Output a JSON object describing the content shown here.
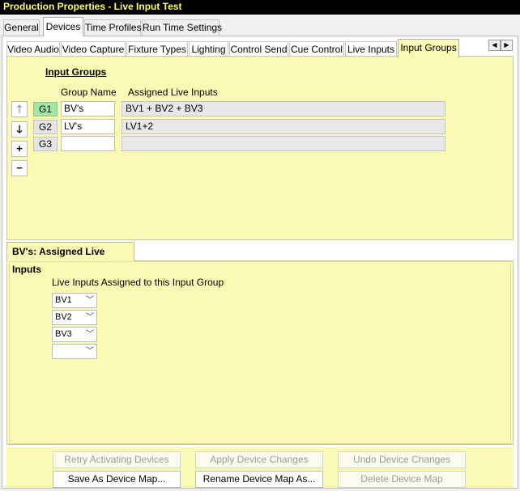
{
  "window": {
    "title": "Production Properties - Live Input Test"
  },
  "outer_tabs": [
    {
      "label": "General"
    },
    {
      "label": "Devices"
    },
    {
      "label": "Time Profiles"
    },
    {
      "label": "Run Time Settings"
    }
  ],
  "inner_tabs": [
    {
      "label": "Video Audio"
    },
    {
      "label": "Video Capture"
    },
    {
      "label": "Fixture Types"
    },
    {
      "label": "Lighting"
    },
    {
      "label": "Control Send"
    },
    {
      "label": "Cue Control"
    },
    {
      "label": "Live Inputs"
    },
    {
      "label": "Input Groups"
    }
  ],
  "input_groups": {
    "title": "Input Groups",
    "col_group_name": "Group Name",
    "col_assigned": "Assigned Live Inputs",
    "rows": [
      {
        "id": "G1",
        "name": "BV's",
        "assigned": "BV1 + BV2 + BV3"
      },
      {
        "id": "G2",
        "name": "LV's",
        "assigned": "LV1+2"
      },
      {
        "id": "G3",
        "name": "",
        "assigned": ""
      }
    ],
    "side_buttons": {
      "up": "🡑",
      "down": "🡓",
      "add": "+",
      "remove": "−"
    }
  },
  "assigned_panel": {
    "tab_label": "BV's: Assigned Live Inputs",
    "label": "Live Inputs Assigned to this Input Group",
    "dropdowns": [
      {
        "value": "BV1"
      },
      {
        "value": "BV2"
      },
      {
        "value": "BV3"
      },
      {
        "value": ""
      }
    ]
  },
  "buttons": {
    "retry": "Retry Activating Devices",
    "apply": "Apply Device Changes",
    "undo": "Undo Device Changes",
    "save_as": "Save As Device Map...",
    "rename": "Rename Device Map As...",
    "delete": "Delete Device Map"
  }
}
